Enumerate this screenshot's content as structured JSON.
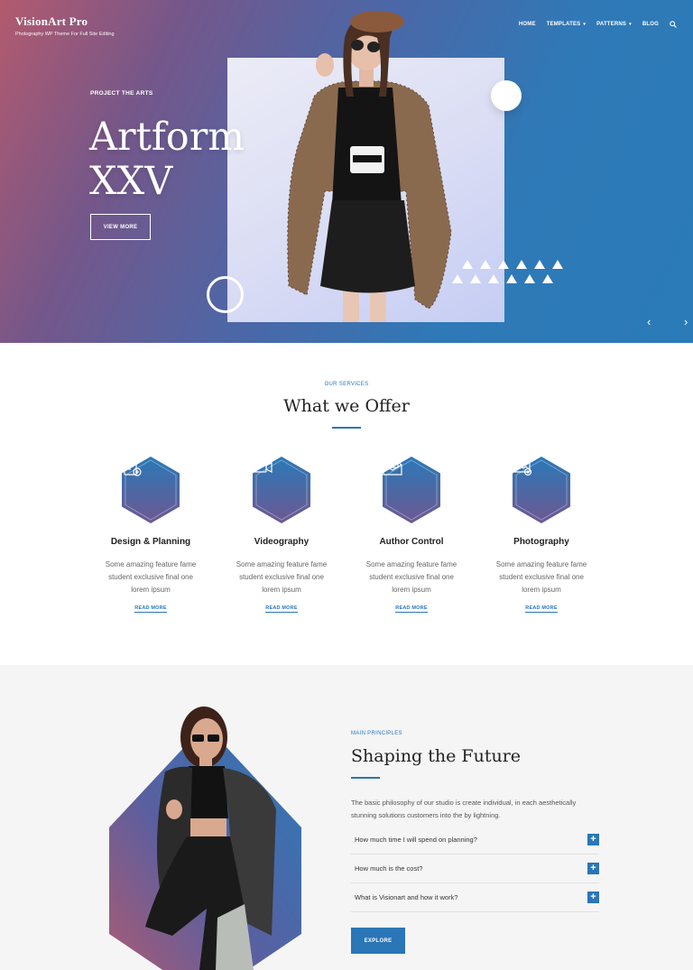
{
  "colors": {
    "accent": "#2a76b6",
    "hero_warm": "#b35a6e",
    "hero_cool": "#2a7bb8",
    "section_bg": "#f5f5f5"
  },
  "brand": {
    "title": "VisionArt Pro",
    "tagline": "Photography WP Theme For Full Site Editing"
  },
  "nav": {
    "items": [
      {
        "label": "HOME"
      },
      {
        "label": "TEMPLATES"
      },
      {
        "label": "PATTERNS"
      },
      {
        "label": "BLOG"
      }
    ],
    "search_icon": "search-icon"
  },
  "hero": {
    "kicker": "PROJECT THE ARTS",
    "title_line1": "Artform",
    "title_line2": "XXV",
    "button_label": "VIEW MORE",
    "prev_icon": "chevron-left-icon",
    "next_icon": "chevron-right-icon"
  },
  "services": {
    "eyebrow": "OUR SERVICES",
    "heading": "What we Offer",
    "cards": [
      {
        "icon": "clipboard-plus-icon",
        "title": "Design & Planning",
        "desc": "Some amazing feature fame student exclusive final one lorem ipsum",
        "link": "READ MORE"
      },
      {
        "icon": "video-camera-icon",
        "title": "Videography",
        "desc": "Some amazing feature fame student exclusive final one lorem ipsum",
        "link": "READ MORE"
      },
      {
        "icon": "envelope-icon",
        "title": "Author Control",
        "desc": "Some amazing feature fame student exclusive final one lorem ipsum",
        "link": "READ MORE"
      },
      {
        "icon": "image-settings-icon",
        "title": "Photography",
        "desc": "Some amazing feature fame student exclusive final one lorem ipsum",
        "link": "READ MORE"
      }
    ]
  },
  "principles": {
    "eyebrow": "MAIN PRINCIPLES",
    "heading": "Shaping the Future",
    "body": "The basic philosophy of our studio is create individual, in each aesthetically stunning solutions customers into the by lightning.",
    "faqs": [
      {
        "question": "How much time I will spend on planning?",
        "toggle": "+"
      },
      {
        "question": "How much is the cost?",
        "toggle": "+"
      },
      {
        "question": "What is Visionart and how it work?",
        "toggle": "+"
      }
    ],
    "button_label": "EXPLORE"
  }
}
